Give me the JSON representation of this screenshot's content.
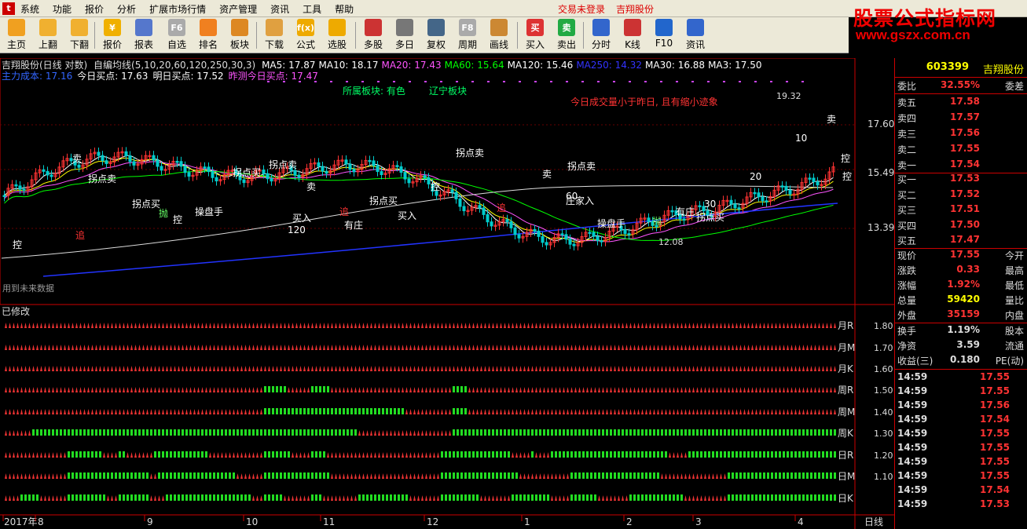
{
  "menu": {
    "items": [
      "系统",
      "功能",
      "报价",
      "分析",
      "扩展市场行情",
      "资产管理",
      "资讯",
      "工具",
      "帮助"
    ],
    "login_status": "交易未登录",
    "stock_name": "吉翔股份"
  },
  "watermark": {
    "line1": "股票公式指标网",
    "line2": "www.gszx.com.cn"
  },
  "toolbar": {
    "buttons": [
      "主页",
      "上翻",
      "下翻",
      "报价",
      "报表",
      "自选",
      "排名",
      "板块",
      "下载",
      "公式",
      "选股",
      "多股",
      "多日",
      "复权",
      "周期",
      "画线",
      "买入",
      "卖出",
      "分时",
      "K线",
      "F10",
      "资讯"
    ],
    "icon_text": [
      "",
      "",
      "",
      "¥",
      "",
      "F6",
      "",
      "",
      "",
      "f(x)",
      "",
      "",
      "",
      "",
      "F8",
      "",
      "买",
      "卖",
      "",
      "",
      "",
      ""
    ]
  },
  "chart": {
    "title_name": "吉翔股份(日线 对数)",
    "title_indicator": "自编均线(5,10,20,60,120,250,30,3)",
    "ma_labels": [
      {
        "text": "MA5: 17.87",
        "color": "#ffffff"
      },
      {
        "text": "MA10: 18.17",
        "color": "#ffffff"
      },
      {
        "text": "MA20: 17.43",
        "color": "#ff55ff"
      },
      {
        "text": "MA60: 15.64",
        "color": "#00ff00"
      },
      {
        "text": "MA120: 15.46",
        "color": "#ffffff"
      },
      {
        "text": "MA250: 14.32",
        "color": "#3333ff"
      },
      {
        "text": "MA30: 16.88",
        "color": "#ffffff"
      },
      {
        "text": "MA3: 17.50",
        "color": "#ffffff"
      }
    ],
    "info_labels": [
      {
        "text": "主力成本: 17.16",
        "color": "#3366ff"
      },
      {
        "text": "今日买点: 17.63",
        "color": "#ffffff"
      },
      {
        "text": "明日买点: 17.52",
        "color": "#ffffff"
      },
      {
        "text": "昨测今日买点: 17.47",
        "color": "#ff55ff"
      }
    ],
    "sector_text": "所属板块: 有色",
    "region_text": "辽宁板块",
    "volume_note": "今日成交量小于昨日, 且有缩小迹象",
    "price_axis": [
      "17.60",
      "15.49",
      "13.39"
    ],
    "high_label": "19.32",
    "low_label": "12.08",
    "future_note": "用到未来数据",
    "annotations": [
      {
        "text": "卖",
        "color": "#ffffff"
      },
      {
        "text": "拐点卖",
        "color": "#ffffff"
      },
      {
        "text": "拐点买",
        "color": "#ffffff"
      },
      {
        "text": "控",
        "color": "#ffffff"
      },
      {
        "text": "追",
        "color": "#ff3333"
      },
      {
        "text": "抛",
        "color": "#66ff66"
      },
      {
        "text": "买入",
        "color": "#ffffff"
      },
      {
        "text": "有庄",
        "color": "#ffffff"
      },
      {
        "text": "操盘手",
        "color": "#ffffff"
      },
      {
        "text": "庄家入",
        "color": "#ffffff"
      },
      {
        "text": "120",
        "color": "#ffffff"
      },
      {
        "text": "30",
        "color": "#ffffff"
      },
      {
        "text": "20",
        "color": "#ffffff"
      },
      {
        "text": "10",
        "color": "#ffffff"
      },
      {
        "text": "60",
        "color": "#ffffff"
      }
    ]
  },
  "lower_panel": {
    "title": "已修改",
    "rows": [
      {
        "label": "月R",
        "value": "1.80"
      },
      {
        "label": "月M",
        "value": "1.70"
      },
      {
        "label": "月K",
        "value": "1.60"
      },
      {
        "label": "周R",
        "value": "1.50"
      },
      {
        "label": "周M",
        "value": "1.40"
      },
      {
        "label": "周K",
        "value": "1.30"
      },
      {
        "label": "日R",
        "value": "1.20"
      },
      {
        "label": "日M",
        "value": "1.10"
      },
      {
        "label": "日K",
        "value": ""
      }
    ],
    "date_axis": [
      "2017年",
      "8",
      "9",
      "10",
      "11",
      "12",
      "1",
      "2",
      "3",
      "4"
    ],
    "period_label": "日线"
  },
  "quote": {
    "code": "603399",
    "name": "吉翔股份",
    "weibi_label": "委比",
    "weibi": "32.55%",
    "weicha_label": "委差",
    "asks": [
      {
        "label": "卖五",
        "price": "17.58"
      },
      {
        "label": "卖四",
        "price": "17.57"
      },
      {
        "label": "卖三",
        "price": "17.56"
      },
      {
        "label": "卖二",
        "price": "17.55"
      },
      {
        "label": "卖一",
        "price": "17.54"
      }
    ],
    "bids": [
      {
        "label": "买一",
        "price": "17.53"
      },
      {
        "label": "买二",
        "price": "17.52"
      },
      {
        "label": "买三",
        "price": "17.51"
      },
      {
        "label": "买四",
        "price": "17.50"
      },
      {
        "label": "买五",
        "price": "17.47"
      }
    ],
    "stats": [
      {
        "label": "现价",
        "value": "17.55",
        "label2": "今开",
        "color": "#ff3333"
      },
      {
        "label": "涨跌",
        "value": "0.33",
        "label2": "最高",
        "color": "#ff3333"
      },
      {
        "label": "涨幅",
        "value": "1.92%",
        "label2": "最低",
        "color": "#ff3333"
      },
      {
        "label": "总量",
        "value": "59420",
        "label2": "量比",
        "color": "#ffff00"
      },
      {
        "label": "外盘",
        "value": "35159",
        "label2": "内盘",
        "color": "#ff3333"
      }
    ],
    "stats2": [
      {
        "label": "换手",
        "value": "1.19%",
        "label2": "股本"
      },
      {
        "label": "净资",
        "value": "3.59",
        "label2": "流通"
      },
      {
        "label": "收益(三)",
        "value": "0.180",
        "label2": "PE(动)"
      }
    ],
    "ticks": [
      {
        "time": "14:59",
        "price": "17.55"
      },
      {
        "time": "14:59",
        "price": "17.55"
      },
      {
        "time": "14:59",
        "price": "17.56"
      },
      {
        "time": "14:59",
        "price": "17.54"
      },
      {
        "time": "14:59",
        "price": "17.55"
      },
      {
        "time": "14:59",
        "price": "17.55"
      },
      {
        "time": "14:59",
        "price": "17.55"
      },
      {
        "time": "14:59",
        "price": "17.55"
      },
      {
        "time": "14:59",
        "price": "17.54"
      },
      {
        "time": "14:59",
        "price": "17.53"
      }
    ]
  }
}
